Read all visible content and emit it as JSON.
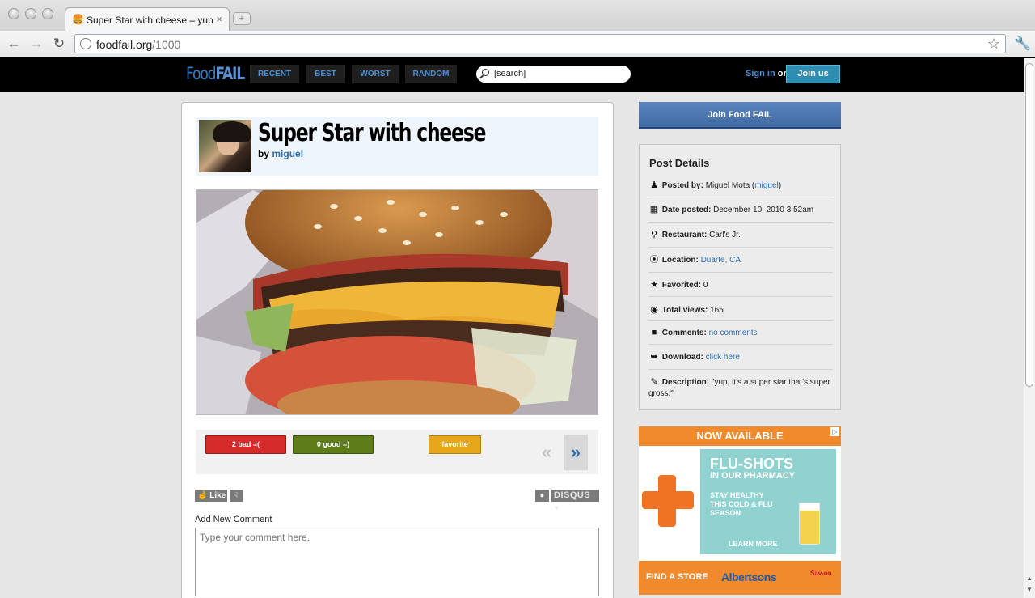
{
  "browser": {
    "tab_title": "Super Star with cheese – yup, it's a super star that's super gross.",
    "tab_close": "×",
    "new_tab": "+",
    "url_domain": "foodfail.org",
    "url_path": "/1000",
    "back": "←",
    "forward": "→",
    "reload": "↻",
    "star": "☆",
    "wrench": "🔧",
    "favicon": "🍔"
  },
  "site": {
    "logo_food": "Food",
    "logo_fail": "FAIL",
    "nav": [
      "RECENT",
      "BEST",
      "WORST",
      "RANDOM"
    ],
    "search_placeholder": "[search]",
    "signin": "Sign in",
    "or": "or",
    "joinus": "Join us"
  },
  "post": {
    "title": "Super Star with cheese",
    "by_label": "by",
    "author": "miguel",
    "bad_label": "2 bad =(",
    "good_label": "0 good =)",
    "favorite_label": "favorite",
    "prev": "«",
    "next": "»"
  },
  "comments": {
    "like": "Like",
    "disqus": "DISQUS",
    "add_label": "Add New Comment",
    "placeholder": "Type your comment here."
  },
  "sidebar": {
    "join_banner": "Join Food FAIL",
    "details_title": "Post Details",
    "rows": [
      {
        "icon": "user-icon",
        "label": "Posted by:",
        "text": "Miguel Mota (",
        "link": "miguel",
        "after": ")"
      },
      {
        "icon": "calendar-icon",
        "label": "Date posted:",
        "text": "December 10, 2010 3:52am"
      },
      {
        "icon": "map-pin-icon",
        "label": "Restaurant:",
        "text": "Carl's Jr."
      },
      {
        "icon": "compass-icon",
        "label": "Location:",
        "text": "",
        "link": "Duarte, CA"
      },
      {
        "icon": "star-icon",
        "label": "Favorited:",
        "text": "0"
      },
      {
        "icon": "eye-icon",
        "label": "Total views:",
        "text": "165"
      },
      {
        "icon": "speech-bubble-icon",
        "label": "Comments:",
        "text": "",
        "link": "no comments"
      },
      {
        "icon": "download-icon",
        "label": "Download:",
        "text": "",
        "link": "click here"
      },
      {
        "icon": "pencil-icon",
        "label": "Description:",
        "text": "\"yup, it's a super star that's super gross.\""
      }
    ]
  },
  "ad": {
    "top": "NOW AVAILABLE",
    "headline": "FLU-SHOTS",
    "sub": "IN OUR PHARMACY",
    "stay": "STAY HEALTHY THIS COLD & FLU SEASON",
    "learn": "LEARN MORE",
    "find": "FIND A STORE",
    "brand": "Albertsons",
    "savon": "Sav-on",
    "choice": "▷"
  },
  "colors": {
    "bad": "#d62b2b",
    "good": "#5e7d1a",
    "favorite": "#e6a81a",
    "link": "#2e6fae",
    "nav_text": "#4c8ed0"
  }
}
